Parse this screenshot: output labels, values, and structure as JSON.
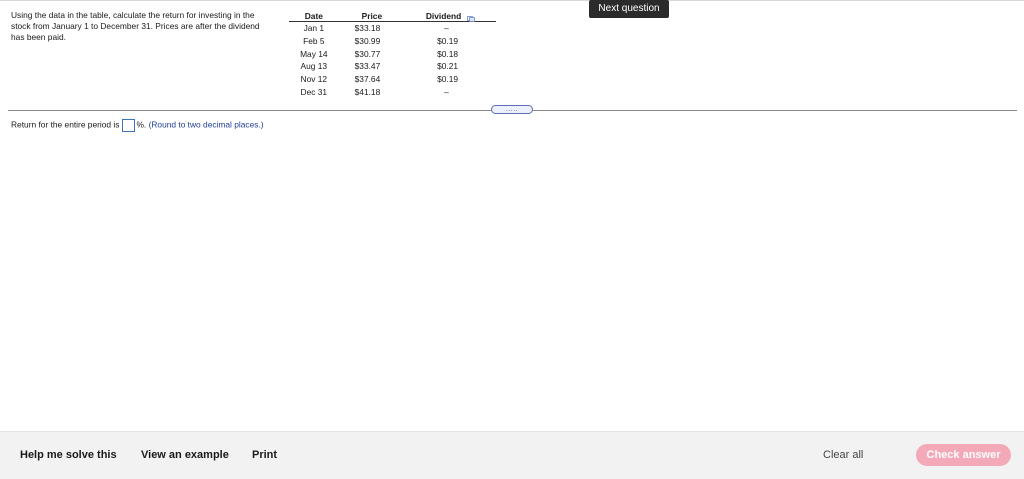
{
  "question": {
    "text": "Using the data in the table, calculate the return for investing in the stock from January 1 to December 31. Prices are after the dividend has been paid."
  },
  "table": {
    "headers": [
      "Date",
      "Price",
      "Dividend"
    ],
    "rows": [
      {
        "date": "Jan 1",
        "price": "$33.18",
        "dividend": "–"
      },
      {
        "date": "Feb 5",
        "price": "$30.99",
        "dividend": "$0.19"
      },
      {
        "date": "May 14",
        "price": "$30.77",
        "dividend": "$0.18"
      },
      {
        "date": "Aug 13",
        "price": "$33.47",
        "dividend": "$0.21"
      },
      {
        "date": "Nov 12",
        "price": "$37.64",
        "dividend": "$0.19"
      },
      {
        "date": "Dec 31",
        "price": "$41.18",
        "dividend": "–"
      }
    ]
  },
  "header": {
    "next_label": "Next question"
  },
  "expander": {
    "label": "....."
  },
  "answer": {
    "prefix": "Return for the entire period is",
    "value": "",
    "suffix": "%.",
    "hint": "(Round to two decimal places.)"
  },
  "footer": {
    "help_label": "Help me solve this",
    "example_label": "View an example",
    "print_label": "Print",
    "clear_label": "Clear all",
    "check_label": "Check answer"
  },
  "colors": {
    "next_button_bg": "#2b2b2b",
    "check_button_bg": "#f4a9b8",
    "hint_text": "#1f3d99",
    "input_border": "#3b73b9"
  },
  "icons": {
    "copy": "copy-icon"
  }
}
